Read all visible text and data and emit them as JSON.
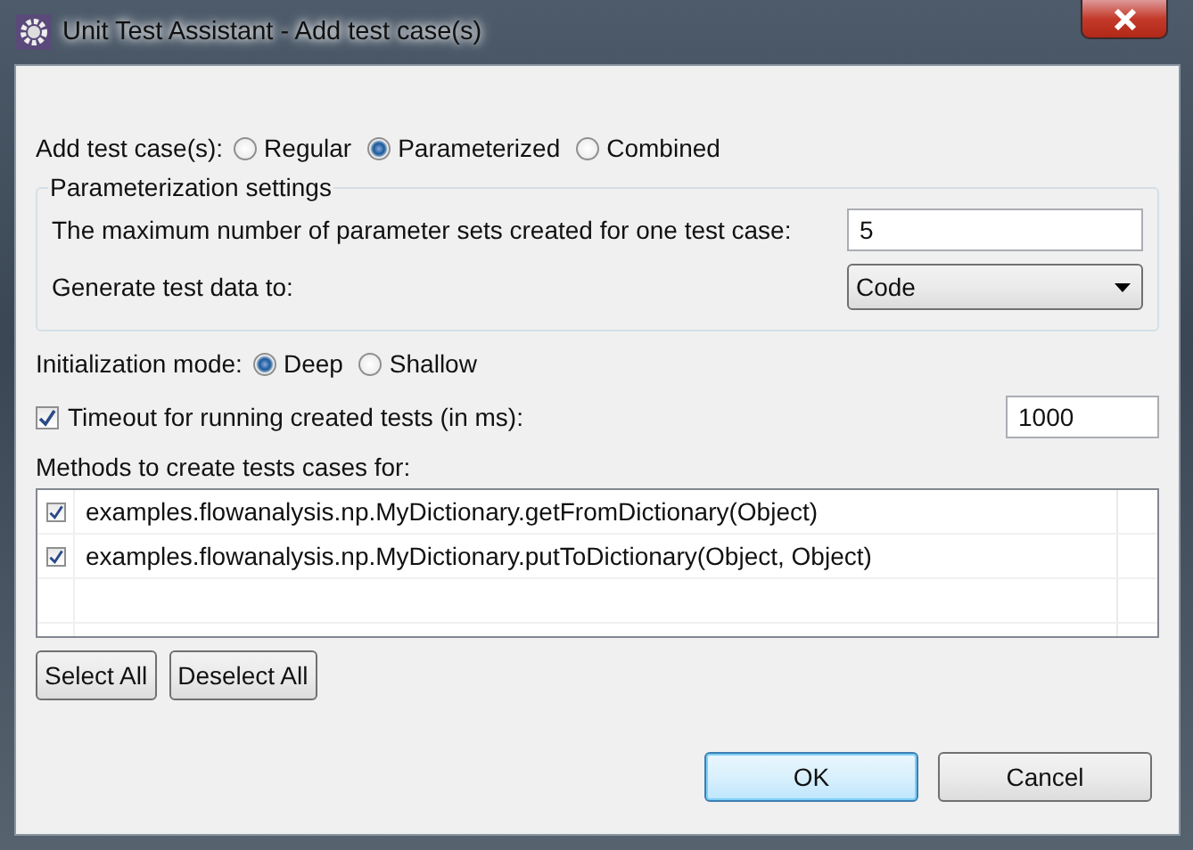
{
  "window": {
    "title": "Unit Test Assistant - Add test case(s)"
  },
  "add_test_cases": {
    "label": "Add test case(s):",
    "options": [
      {
        "label": "Regular",
        "selected": false
      },
      {
        "label": "Parameterized",
        "selected": true
      },
      {
        "label": "Combined",
        "selected": false
      }
    ]
  },
  "parameterization": {
    "title": "Parameterization settings",
    "max_sets": {
      "label": "The maximum number of parameter sets created for one test case:",
      "value": "5"
    },
    "generate_to": {
      "label": "Generate test data to:",
      "value": "Code"
    }
  },
  "initialization": {
    "label": "Initialization mode:",
    "options": [
      {
        "label": "Deep",
        "selected": true
      },
      {
        "label": "Shallow",
        "selected": false
      }
    ]
  },
  "timeout": {
    "label": "Timeout for running created tests (in ms):",
    "checked": true,
    "value": "1000"
  },
  "methods": {
    "label": "Methods to create tests cases for:",
    "items": [
      {
        "label": "examples.flowanalysis.np.MyDictionary.getFromDictionary(Object)",
        "checked": true
      },
      {
        "label": "examples.flowanalysis.np.MyDictionary.putToDictionary(Object, Object)",
        "checked": true
      }
    ]
  },
  "list_buttons": [
    "Select All",
    "Deselect All"
  ],
  "buttons": [
    {
      "label": "OK",
      "default": true
    },
    {
      "label": "Cancel",
      "default": false
    }
  ]
}
